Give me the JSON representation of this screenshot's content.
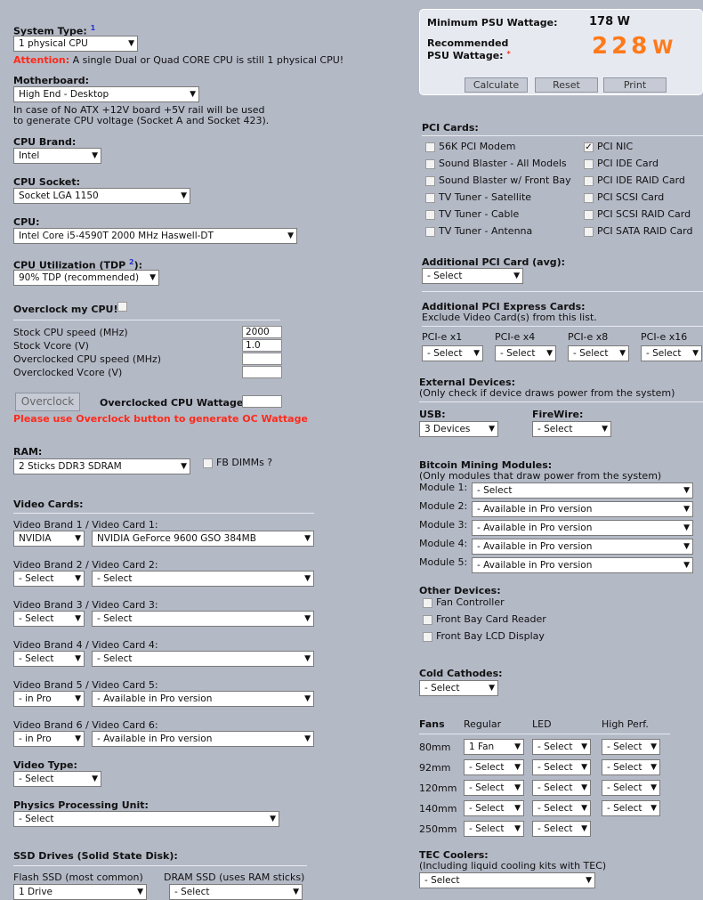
{
  "left": {
    "system_type": {
      "label": "System Type:",
      "sup": "1",
      "value": "1 physical CPU",
      "att_prefix": "Attention:",
      "att_text": " A single Dual or Quad CORE CPU is still 1 physical CPU!"
    },
    "motherboard": {
      "label": "Motherboard:",
      "value": "High End - Desktop",
      "note1": "In case of No ATX +12V board +5V rail will be used",
      "note2": "to generate CPU voltage (Socket A and Socket 423)."
    },
    "cpu_brand": {
      "label": "CPU Brand:",
      "value": "Intel"
    },
    "cpu_socket": {
      "label": "CPU Socket:",
      "value": "Socket LGA 1150"
    },
    "cpu": {
      "label": "CPU:",
      "value": "Intel Core i5-4590T 2000 MHz Haswell-DT"
    },
    "cpu_util": {
      "label": "CPU Utilization (TDP",
      "sup": "2",
      "suffix": "):",
      "value": "90% TDP (recommended)"
    },
    "overclock": {
      "label": "Overclock my CPU!",
      "stock_speed_label": "Stock CPU speed (MHz)",
      "stock_speed": "2000",
      "stock_vcore_label": "Stock Vcore (V)",
      "stock_vcore": "1.0",
      "oc_speed_label": "Overclocked CPU speed (MHz)",
      "oc_speed": "",
      "oc_vcore_label": "Overclocked Vcore (V)",
      "oc_vcore": "",
      "button": "Overclock",
      "wattage_label": "Overclocked CPU Wattage:",
      "wattage": "",
      "warning": "Please use Overclock button to generate OC Wattage"
    },
    "ram": {
      "label": "RAM:",
      "value": "2 Sticks DDR3 SDRAM",
      "fb_label": "FB DIMMs ?"
    },
    "video_cards": {
      "label": "Video Cards:",
      "rows": [
        {
          "label": "Video Brand 1 / Video Card 1:",
          "brand": "NVIDIA",
          "card": "NVIDIA GeForce 9600 GSO 384MB"
        },
        {
          "label": "Video Brand 2 / Video Card 2:",
          "brand": "- Select",
          "card": "- Select"
        },
        {
          "label": "Video Brand 3 / Video Card 3:",
          "brand": "- Select",
          "card": "- Select"
        },
        {
          "label": "Video Brand 4 / Video Card 4:",
          "brand": "- Select",
          "card": "- Select"
        },
        {
          "label": "Video Brand 5 / Video Card 5:",
          "brand": "- in Pro",
          "card": "- Available in Pro version"
        },
        {
          "label": "Video Brand 6 / Video Card 6:",
          "brand": "- in Pro",
          "card": "- Available in Pro version"
        }
      ]
    },
    "video_type": {
      "label": "Video Type:",
      "value": "- Select"
    },
    "ppu": {
      "label": "Physics Processing Unit:",
      "value": "- Select"
    },
    "ssd": {
      "label": "SSD Drives (Solid State Disk):",
      "flash_label": "Flash SSD (most common)",
      "flash_value": "1 Drive",
      "dram_label": "DRAM SSD (uses RAM sticks)",
      "dram_value": "- Select"
    }
  },
  "right": {
    "min_label": "Minimum PSU Wattage:",
    "min_value": "178 W",
    "rec_label1": "Recommended",
    "rec_label2": "PSU Wattage:",
    "rec_star": "*",
    "rec_value": "228",
    "rec_unit": "W",
    "calc": "Calculate",
    "reset": "Reset",
    "print": "Print",
    "pci": {
      "label": "PCI Cards:",
      "items": [
        {
          "name": "56K PCI Modem",
          "checked": false
        },
        {
          "name": "PCI NIC",
          "checked": true
        },
        {
          "name": "Sound Blaster - All Models",
          "checked": false
        },
        {
          "name": "PCI IDE Card",
          "checked": false
        },
        {
          "name": "Sound Blaster w/ Front Bay",
          "checked": false
        },
        {
          "name": "PCI IDE RAID Card",
          "checked": false
        },
        {
          "name": "TV Tuner - Satellite",
          "checked": false
        },
        {
          "name": "PCI SCSI Card",
          "checked": false
        },
        {
          "name": "TV Tuner - Cable",
          "checked": false
        },
        {
          "name": "PCI SCSI RAID Card",
          "checked": false
        },
        {
          "name": "TV Tuner - Antenna",
          "checked": false
        },
        {
          "name": "PCI SATA RAID Card",
          "checked": false
        }
      ]
    },
    "add_pci": {
      "label": "Additional PCI Card (avg):",
      "value": "- Select"
    },
    "pcie": {
      "label": "Additional PCI Express Cards:",
      "note": "Exclude Video Card(s) from this list.",
      "slots": [
        {
          "label": "PCI-e x1",
          "value": "- Select"
        },
        {
          "label": "PCI-e x4",
          "value": "- Select"
        },
        {
          "label": "PCI-e x8",
          "value": "- Select"
        },
        {
          "label": "PCI-e x16",
          "value": "- Select"
        }
      ]
    },
    "external": {
      "label": "External Devices:",
      "note": "(Only check if device draws power from the system)",
      "usb_label": "USB:",
      "usb_value": "3 Devices",
      "fw_label": "FireWire:",
      "fw_value": "- Select"
    },
    "bitcoin": {
      "label": "Bitcoin Mining Modules:",
      "note": "(Only modules that draw power from the system)",
      "modules": [
        {
          "label": "Module 1:",
          "value": "- Select"
        },
        {
          "label": "Module 2:",
          "value": "- Available in Pro version"
        },
        {
          "label": "Module 3:",
          "value": "- Available in Pro version"
        },
        {
          "label": "Module 4:",
          "value": "- Available in Pro version"
        },
        {
          "label": "Module 5:",
          "value": "- Available in Pro version"
        }
      ]
    },
    "other": {
      "label": "Other Devices:",
      "items": [
        "Fan Controller",
        "Front Bay Card Reader",
        "Front Bay LCD Display"
      ]
    },
    "cold": {
      "label": "Cold Cathodes:",
      "value": "- Select"
    },
    "fans": {
      "label": "Fans",
      "col_regular": "Regular",
      "col_led": "LED",
      "col_high": "High Perf.",
      "rows": [
        {
          "size": "80mm",
          "regular": "1 Fan",
          "led": "- Select",
          "high": "- Select"
        },
        {
          "size": "92mm",
          "regular": "- Select",
          "led": "- Select",
          "high": "- Select"
        },
        {
          "size": "120mm",
          "regular": "- Select",
          "led": "- Select",
          "high": "- Select"
        },
        {
          "size": "140mm",
          "regular": "- Select",
          "led": "- Select",
          "high": "- Select"
        },
        {
          "size": "250mm",
          "regular": "- Select",
          "led": "- Select"
        }
      ]
    },
    "tec": {
      "label": "TEC Coolers:",
      "note": "(Including liquid cooling kits with TEC)",
      "value": "- Select"
    }
  }
}
